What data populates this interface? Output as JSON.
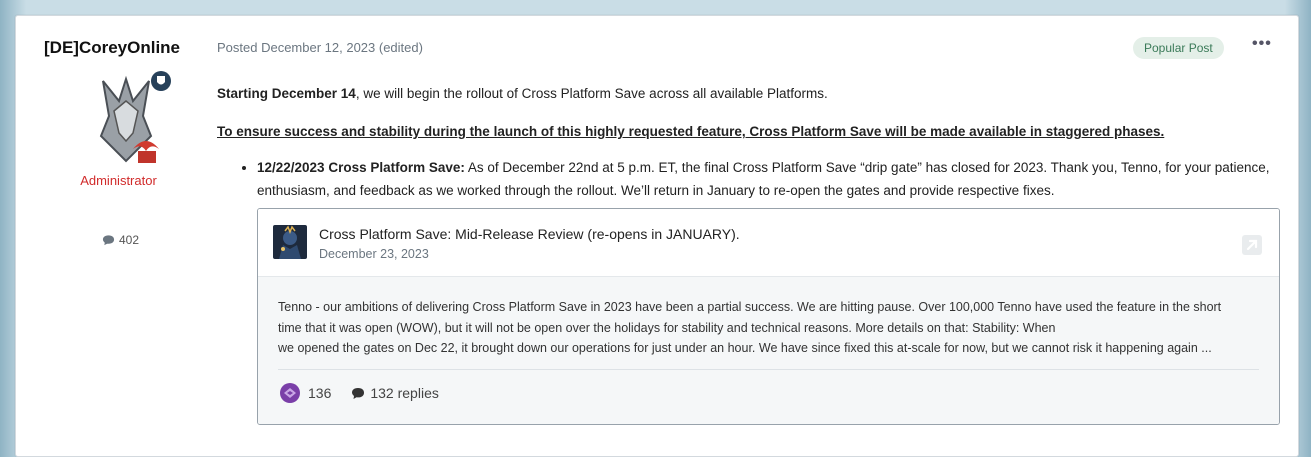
{
  "author": {
    "name": "[DE]CoreyOnline",
    "role": "Administrator",
    "post_count": "402"
  },
  "post": {
    "posted": "Posted December 12, 2023 (edited)",
    "badge": "Popular Post",
    "more_label": "•••",
    "intro_bold": "Starting December 14",
    "intro_rest": ", we will begin the rollout of Cross Platform Save across all available Platforms.",
    "notice": "To ensure success and stability during the launch of this highly requested feature, Cross Platform Save will be made available in staggered phases.",
    "bullet_bold": "12/22/2023 Cross Platform Save:",
    "bullet_rest": " As of December 22nd at 5 p.m. ET, the final Cross Platform Save “drip gate” has closed for 2023. Thank you, Tenno, for your patience, enthusiasm, and feedback as we worked through the rollout. We’ll return in January to re-open the gates and provide respective fixes."
  },
  "embed": {
    "title": "Cross Platform Save: Mid-Release Review (re-opens in JANUARY).",
    "date": "December 23, 2023",
    "excerpt_line1": "Tenno - our ambitions of delivering Cross Platform Save in 2023 have been a partial success. We are hitting pause. Over 100,000 Tenno have used the feature in the short",
    "excerpt_line2": "time that it was open (WOW), but it will not be open over the holidays for stability and technical reasons. More details on that: Stability: When",
    "excerpt_line3": "we opened the gates on Dec 22, it brought down our operations for just under an hour. We have since fixed this at-scale for now, but we cannot risk it happening again ...",
    "reactions": "136",
    "replies": "132 replies"
  },
  "colors": {
    "role": "#d12b2b",
    "badge_bg": "#e4efe8",
    "badge_text": "#3a7a58",
    "reaction": "#7a3fa8"
  }
}
